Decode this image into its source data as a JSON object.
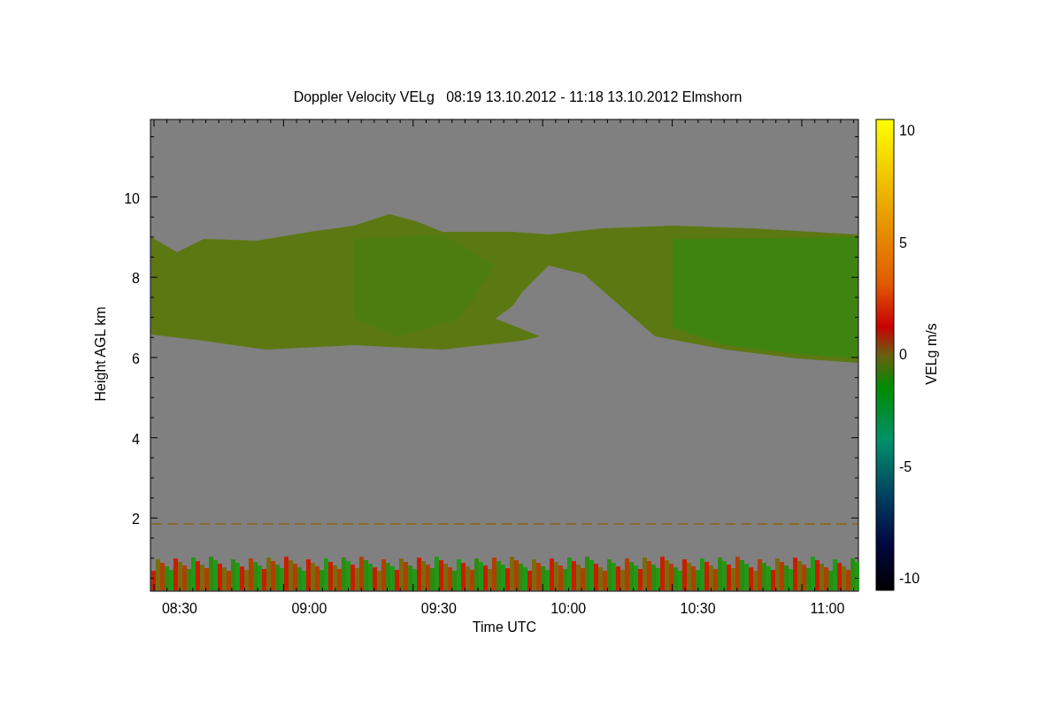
{
  "title": "Doppler Velocity VELg   08:19 13.10.2012 - 11:18 13.10.2012 Elmshorn",
  "y_axis": {
    "label": "Height AGL km",
    "ticks": [
      "10",
      "8",
      "6",
      "4",
      "2"
    ]
  },
  "x_axis": {
    "label": "Time UTC",
    "ticks": [
      "08:30",
      "09:00",
      "09:30",
      "10:00",
      "10:30",
      "11:00"
    ]
  },
  "colorbar": {
    "label": "VELg m/s",
    "ticks": [
      "10",
      "5",
      "0",
      "-5",
      "-10"
    ]
  }
}
